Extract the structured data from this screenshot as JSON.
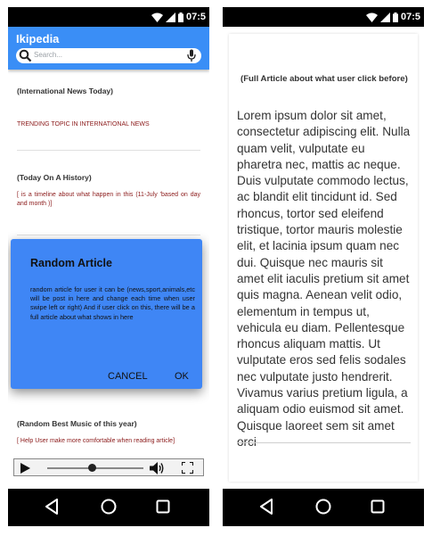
{
  "status_bar": {
    "time": "07:5"
  },
  "left_screen": {
    "app_title": "Ikipedia",
    "search": {
      "placeholder": "Search..."
    },
    "sections": [
      {
        "title": "(International News Today)",
        "body": "TRENDING TOPIC IN INTERNATIONAL NEWS"
      },
      {
        "title": "(Today On A History)",
        "body": "[ is a timeline about what happen in this (11-July 'based on day and month )]"
      },
      {
        "title": "(Random Best Music of this year)",
        "body": "[ Help User make more comfortable when reading article]"
      }
    ],
    "dialog": {
      "title": "Random Article",
      "body": "random article for user it can be (news,sport,animals,etc will be post in here and change each time when user swipe left or right) And if user click on this, there will be a full article about what shows in here",
      "cancel_label": "CANCEL",
      "ok_label": "OK"
    },
    "player": {
      "progress": 0.47
    }
  },
  "right_screen": {
    "article_title": "(Full Article about what user click before)",
    "article_body": "Lorem ipsum dolor sit amet, consectetur adipiscing elit. Nulla quam velit, vulputate eu pharetra nec, mattis ac neque. Duis vulputate commodo lectus, ac blandit elit tincidunt id. Sed rhoncus, tortor sed eleifend tristique, tortor mauris molestie elit, et lacinia ipsum quam nec dui. Quisque nec mauris sit amet elit iaculis pretium sit amet quis magna. Aenean velit odio, elementum in tempus ut, vehicula eu diam. Pellentesque rhoncus aliquam mattis. Ut vulputate eros sed felis sodales nec vulputate justo hendrerit. Vivamus varius pretium ligula, a aliquam odio euismod sit amet. Quisque laoreet sem sit amet orci"
  },
  "colors": {
    "accent": "#3a8ef6",
    "dialog": "#3f86f5",
    "section_body": "#8b1a1a"
  },
  "icons": [
    "wifi-icon",
    "signal-icon",
    "battery-icon",
    "search-icon",
    "mic-icon",
    "play-icon",
    "volume-icon",
    "fullscreen-icon",
    "back-icon",
    "home-icon",
    "recent-apps-icon"
  ]
}
